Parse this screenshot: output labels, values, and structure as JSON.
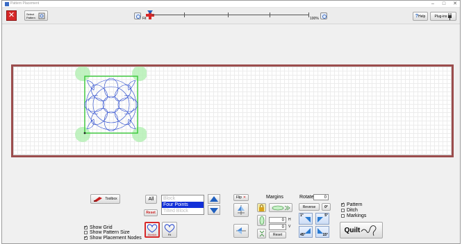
{
  "window": {
    "title": "Pattern Placement",
    "controls": [
      "–",
      "□",
      "✕"
    ]
  },
  "toolbar": {
    "close_label": "✕",
    "select_pattern_label": "Select Pattern",
    "fit_label": "Fit",
    "zoom_max_label": "100%",
    "help_label": "Help",
    "plugins_label": "Plug-ins"
  },
  "bottom": {
    "toolbox_label": "Toolbox",
    "all_label": "All",
    "reset_label": "Reset",
    "list": {
      "items": [
        "Block",
        "Four Points",
        "Tilted Block"
      ],
      "selected": "Four Points"
    },
    "show_grid": "Show Grid",
    "show_pattern_size": "Show Pattern Size",
    "show_placement_nodes": "Show Placement Nodes",
    "stretch_label": "Stretch",
    "fit_label": "Fit",
    "flip_label": "Flip",
    "margins_label": "Margins",
    "margin_h": "0",
    "margin_v": "0",
    "h_label": "H",
    "v_label": "V",
    "margins_reset_label": "Reset",
    "rotate_label": "Rotate",
    "rotate_value": "0",
    "reverse_label": "Reverse",
    "rot_0": "0°",
    "rot_1": "1°",
    "rot_5": "5°",
    "rot_45": "45°",
    "rot_15": "15°",
    "pattern_label": "Pattern",
    "ditch_label": "Ditch",
    "markings_label": "Markings",
    "quilt_label": "Quilt"
  },
  "checks": {
    "show_grid": true,
    "show_pattern_size": false,
    "show_placement_nodes": true,
    "pattern": true,
    "ditch": false,
    "markings": false
  },
  "colors": {
    "canvas_border": "#9b4d4d",
    "selection_box": "#35c735",
    "pattern_stroke": "#2244cc",
    "node_fill": "#b6f0b6",
    "accent_blue": "#1f5fbf",
    "list_selected_bg": "#1230d8",
    "close_red": "#d62828"
  }
}
